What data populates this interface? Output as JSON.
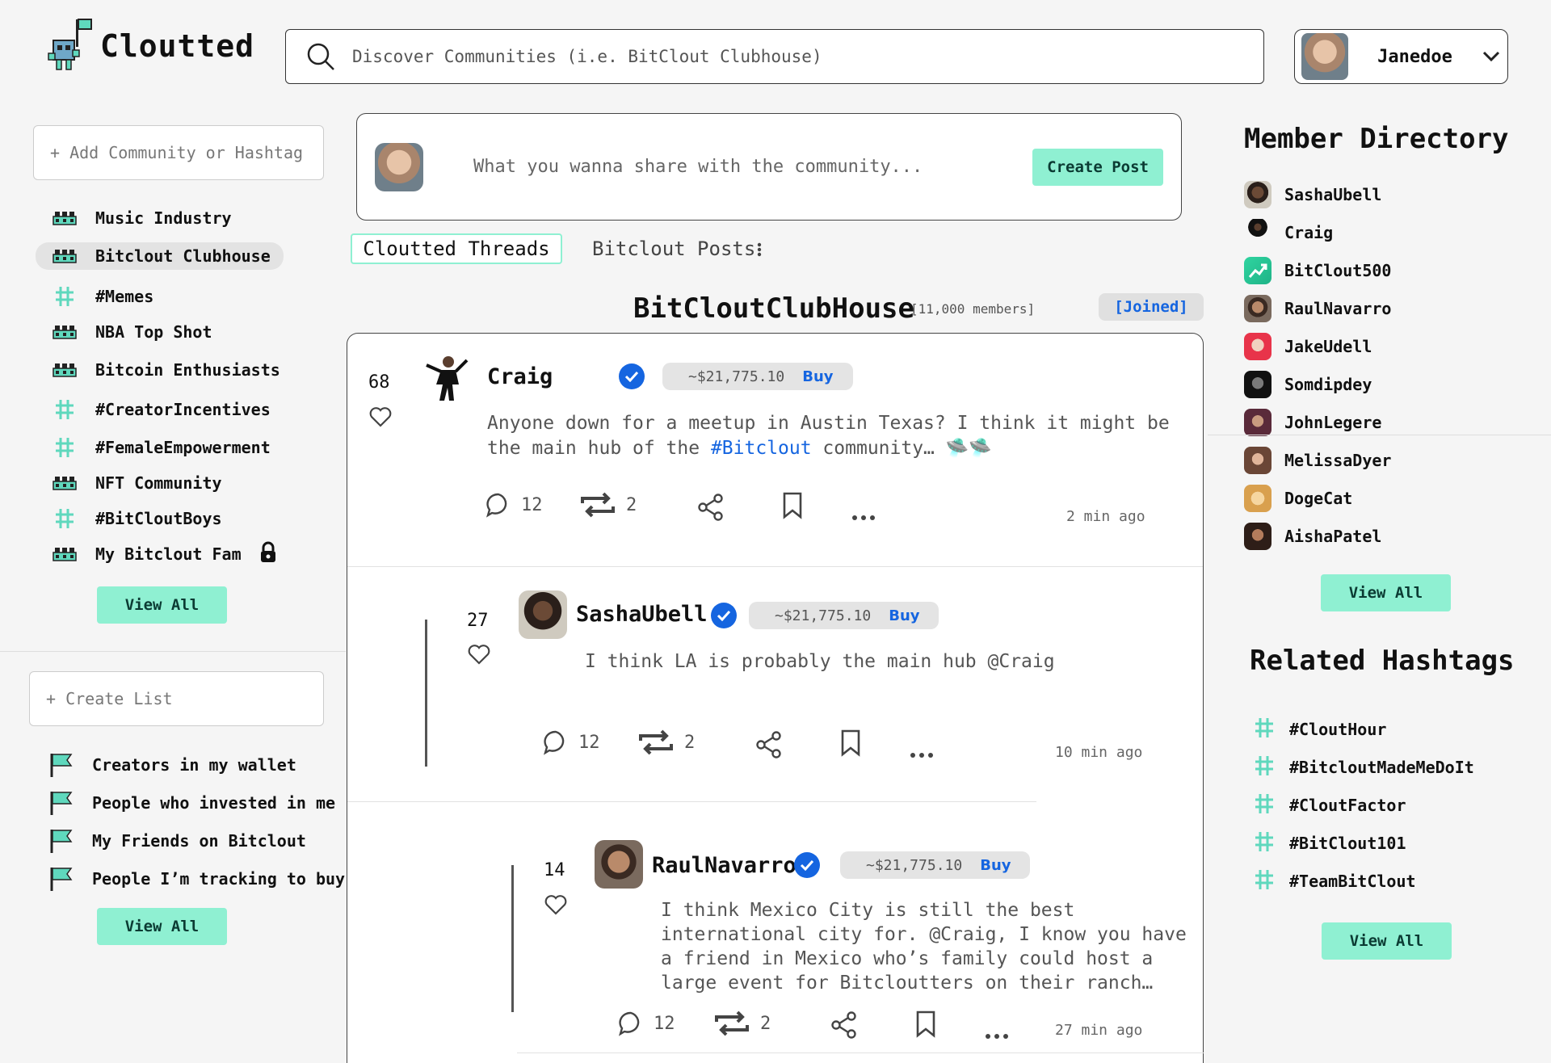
{
  "header": {
    "logo_text": "Cloutted",
    "search_placeholder": "Discover Communities (i.e. BitClout Clubhouse)",
    "user_name": "Janedoe"
  },
  "left_sidebar": {
    "add_placeholder": "+ Add Community or Hashtag",
    "communities": [
      {
        "label": "Music Industry",
        "icon": "community-icon"
      },
      {
        "label": "Bitclout Clubhouse",
        "icon": "community-icon",
        "active": true
      },
      {
        "label": "#Memes",
        "icon": "hashtag-icon"
      },
      {
        "label": "NBA Top Shot",
        "icon": "community-icon"
      },
      {
        "label": "Bitcoin Enthusiasts",
        "icon": "community-icon"
      },
      {
        "label": "#CreatorIncentives",
        "icon": "hashtag-icon"
      },
      {
        "label": "#FemaleEmpowerment",
        "icon": "hashtag-icon"
      },
      {
        "label": "NFT Community",
        "icon": "community-icon"
      },
      {
        "label": "#BitCloutBoys",
        "icon": "hashtag-icon"
      },
      {
        "label": "My Bitclout Fam",
        "icon": "community-icon",
        "locked": true
      }
    ],
    "view_all_label": "View All",
    "create_list_placeholder": "+ Create List",
    "lists": [
      {
        "label": "Creators in my wallet",
        "icon": "flag-icon"
      },
      {
        "label": "People who invested in me",
        "icon": "flag-icon"
      },
      {
        "label": "My Friends on Bitclout",
        "icon": "flag-icon"
      },
      {
        "label": "People I’m tracking to buy",
        "icon": "flag-icon"
      }
    ],
    "lists_view_all_label": "View All"
  },
  "composer": {
    "placeholder": "What you wanna share with the community...",
    "button_label": "Create Post"
  },
  "tabs": [
    {
      "label": "Cloutted Threads",
      "active": true
    },
    {
      "label": "Bitclout Posts"
    }
  ],
  "community": {
    "name": "BitCloutClubHouse",
    "members": "[11,000 members]",
    "joined_label": "[Joined]"
  },
  "posts": [
    {
      "likes": "68",
      "author": "Craig",
      "price": "~$21,775.10",
      "buy_label": "Buy",
      "text_before": "Anyone down for a meetup in Austin Texas? I think it might be the main hub of the ",
      "hashtag": "#Bitclout",
      "text_after": " community… 🛸🛸",
      "comments": "12",
      "reclouts": "2",
      "time": "2 min ago"
    },
    {
      "likes": "27",
      "author": "SashaUbell",
      "price": "~$21,775.10",
      "buy_label": "Buy",
      "text": "I think LA is probably the main hub @Craig",
      "comments": "12",
      "reclouts": "2",
      "time": "10 min ago"
    },
    {
      "likes": "14",
      "author": "RaulNavarro",
      "price": "~$21,775.10",
      "buy_label": "Buy",
      "text": "I think Mexico City is still the best international city for. @Craig, I know you have a friend in Mexico who’s family could host a large event for Bitcloutters on their ranch…",
      "comments": "12",
      "reclouts": "2",
      "time": "27 min ago"
    }
  ],
  "member_directory": {
    "title": "Member Directory",
    "members": [
      "SashaUbell",
      "Craig",
      "BitClout500",
      "RaulNavarro",
      "JakeUdell",
      "Somdipdey",
      "JohnLegere",
      "MelissaDyer",
      "DogeCat",
      "AishaPatel"
    ],
    "view_all_label": "View All"
  },
  "related_hashtags": {
    "title": "Related Hashtags",
    "hashtags": [
      "#CloutHour",
      "#BitcloutMadeMeDoIt",
      "#CloutFactor",
      "#BitClout101",
      "#TeamBitClout"
    ],
    "view_all_label": "View All"
  },
  "colors": {
    "accent": "#8ff0d2",
    "link": "#1565e0",
    "background": "#f5f5f5"
  }
}
